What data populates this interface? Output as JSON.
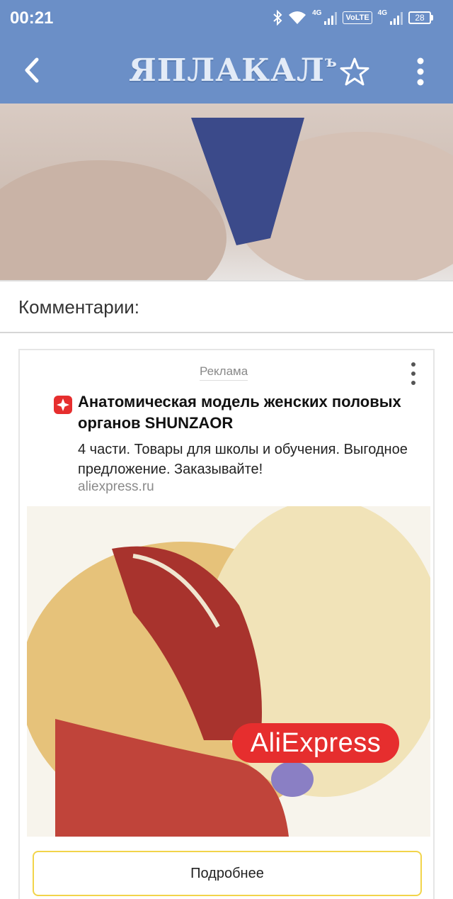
{
  "status_bar": {
    "time": "00:21",
    "network_1": "4G",
    "volte": "VoLTE",
    "network_2": "4G",
    "battery": "28"
  },
  "app_bar": {
    "logo_text": "ЯПЛАКАЛ",
    "logo_suffix": "ъ",
    "icons": [
      "back-arrow",
      "star-outline",
      "more-vertical"
    ]
  },
  "comments": {
    "title": "Комментарии:"
  },
  "ad": {
    "label": "Реклама",
    "title": "Анатомическая модель женских половых органов SHUNZAOR",
    "description": "4 части. Товары для школы и обучения. Выгодное предложение. Заказывайте!",
    "domain": "aliexpress.ru",
    "image_badge": "AliExpress",
    "button_label": "Подробнее",
    "colors": {
      "badge": "#e62e2e",
      "button_border": "#f2d44a",
      "brand": "#6b8fc7"
    }
  }
}
